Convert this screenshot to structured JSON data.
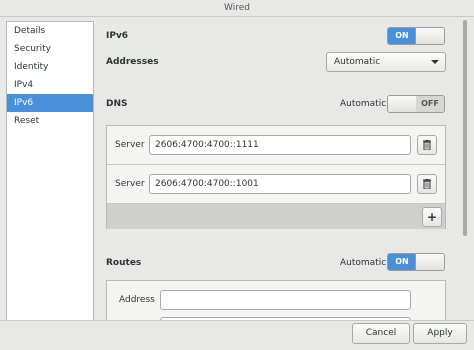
{
  "window": {
    "title": "Wired"
  },
  "sidebar": {
    "items": [
      {
        "label": "Details"
      },
      {
        "label": "Security"
      },
      {
        "label": "Identity"
      },
      {
        "label": "IPv4"
      },
      {
        "label": "IPv6",
        "selected": true
      },
      {
        "label": "Reset"
      }
    ]
  },
  "ipv6": {
    "label": "IPv6",
    "switch": "ON",
    "switch_on": true
  },
  "addresses": {
    "label": "Addresses",
    "value": "Automatic"
  },
  "dns": {
    "label": "DNS",
    "auto_label": "Automatic",
    "switch": "OFF",
    "switch_on": false,
    "servers": [
      {
        "label": "Server",
        "value": "2606:4700:4700::1111"
      },
      {
        "label": "Server",
        "value": "2606:4700:4700::1001"
      }
    ],
    "add_icon": "plus-icon",
    "delete_icon": "trash-icon"
  },
  "routes": {
    "label": "Routes",
    "auto_label": "Automatic",
    "switch": "ON",
    "switch_on": true,
    "address_label": "Address",
    "address_value": ""
  },
  "buttons": {
    "cancel": "Cancel",
    "apply": "Apply"
  },
  "colors": {
    "accent": "#4a90d9"
  }
}
